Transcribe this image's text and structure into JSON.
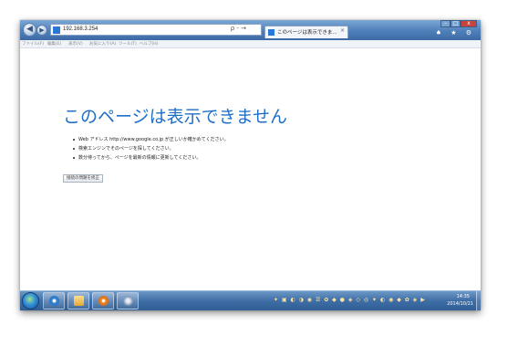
{
  "browser": {
    "address": "192.168.3.254",
    "address_search_glyph": "ρ - →",
    "tab_title": "このページは表示できま...",
    "tab_close": "×",
    "right_icons": "♠ ★ ⚙",
    "menu": [
      "ファイル(F)",
      "編集(E)",
      "表示(V)",
      "お気に入り(A)",
      "ツール(T)",
      "ヘルプ(H)"
    ]
  },
  "page": {
    "heading": "このページは表示できません",
    "bullets": [
      "Web アドレス http://www.google.co.jp が正しいか確かめてください。",
      "検索エンジンでそのページを探してください。",
      "数分待ってから、ページを最新の情報に更新してください。"
    ],
    "fix_button": "接続の問題を修正"
  },
  "taskbar": {
    "time": "14:35",
    "date": "2014/10/21"
  },
  "icons": {
    "back": "back-arrow-icon",
    "forward": "forward-arrow-icon",
    "favicon": "ie-page-icon",
    "start": "windows-start-icon",
    "apps": [
      "internet-explorer-icon",
      "file-explorer-icon",
      "media-player-icon",
      "settings-icon"
    ]
  },
  "colors": {
    "heading": "#1f6fc8",
    "titlebar": "#4f7fb8",
    "taskbar": "#3f6ea6"
  }
}
